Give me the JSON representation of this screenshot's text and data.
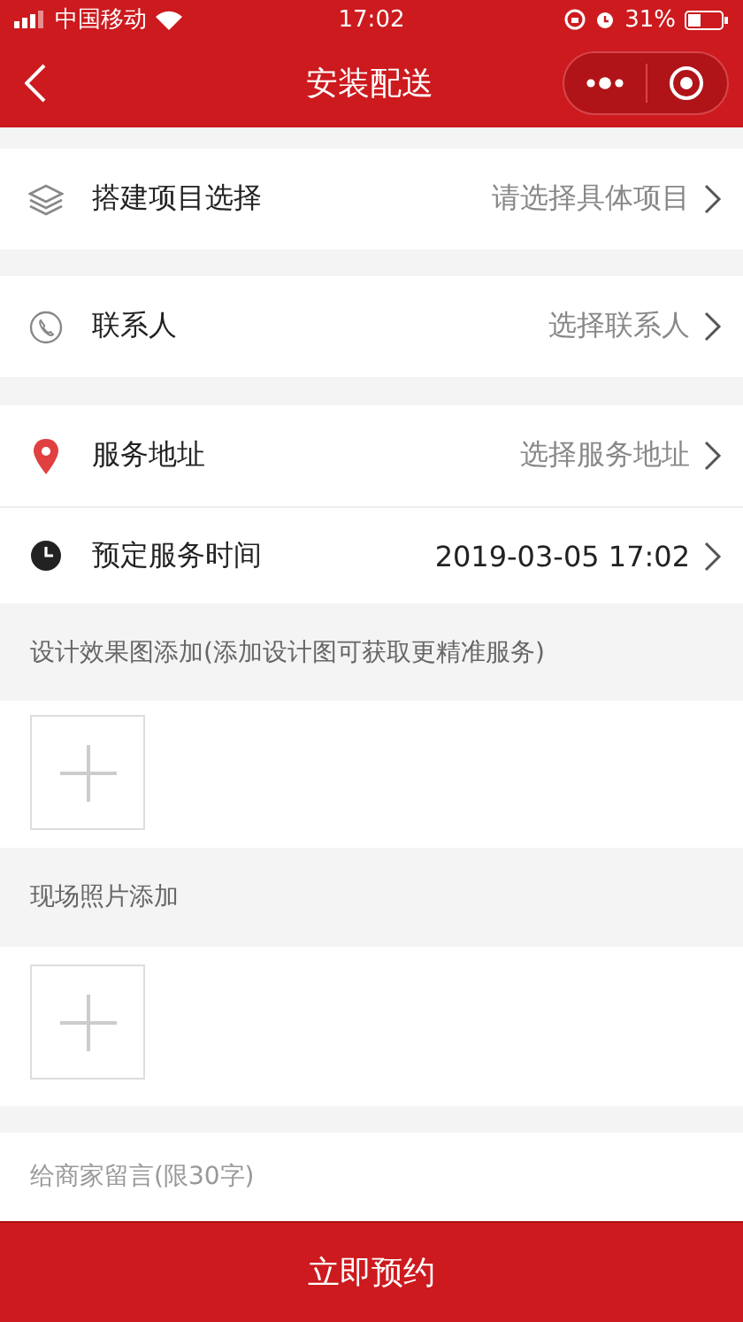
{
  "status_bar": {
    "carrier": "中国移动",
    "time": "17:02",
    "battery": "31%"
  },
  "nav": {
    "title": "安装配送"
  },
  "groups": [
    {
      "rows": [
        {
          "kind": "project",
          "label": "搭建项目选择",
          "placeholder": "请选择具体项目"
        }
      ]
    },
    {
      "rows": [
        {
          "kind": "contact",
          "label": "联系人",
          "placeholder": "选择联系人"
        }
      ]
    },
    {
      "rows": [
        {
          "kind": "address",
          "label": "服务地址",
          "placeholder": "选择服务地址"
        },
        {
          "kind": "time",
          "label": "预定服务时间",
          "value": "2019-03-05 17:02"
        }
      ]
    }
  ],
  "uploads": [
    {
      "label": "设计效果图添加(添加设计图可获取更精准服务)"
    },
    {
      "label": "现场照片添加"
    }
  ],
  "message": {
    "placeholder": "给商家留言(限30字)"
  },
  "submit": {
    "label": "立即预约"
  }
}
